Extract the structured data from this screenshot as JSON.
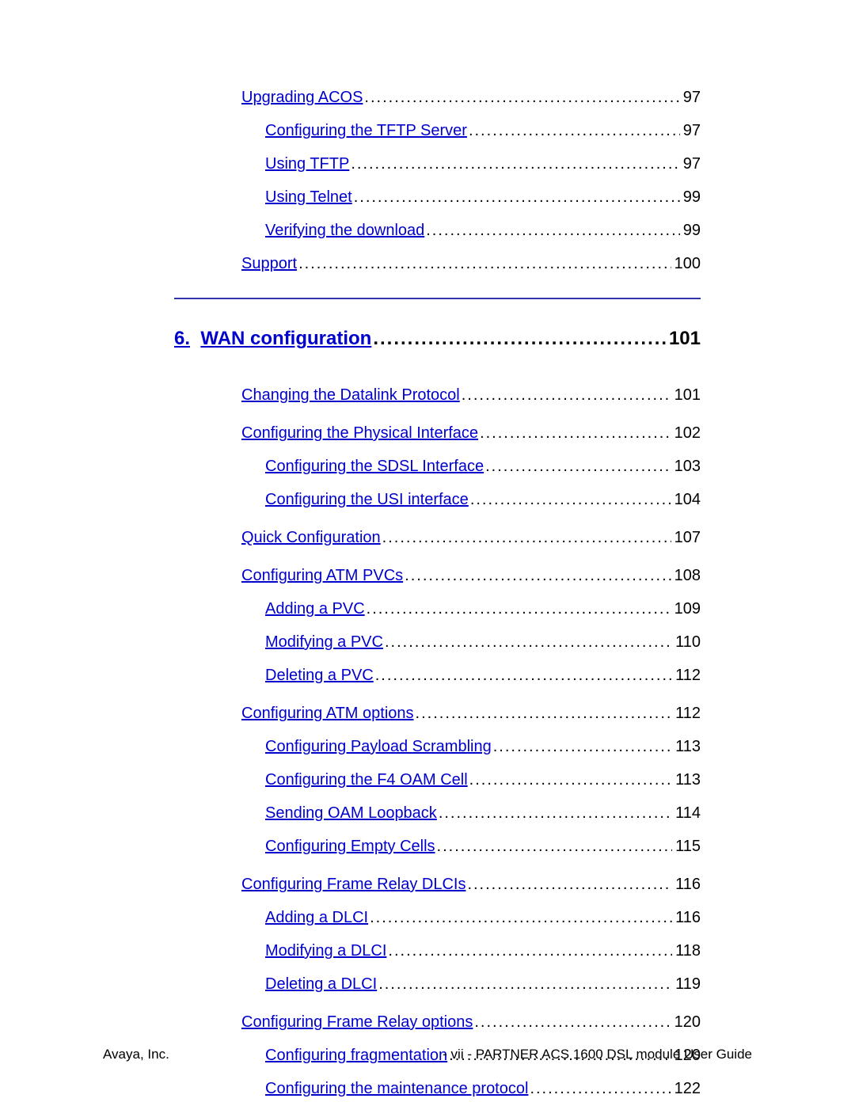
{
  "toc_top": [
    {
      "label": "Upgrading ACOS",
      "page": "97",
      "indent": 1
    },
    {
      "label": "Configuring the TFTP Server",
      "page": "97",
      "indent": 2
    },
    {
      "label": "Using TFTP",
      "page": "97",
      "indent": 2
    },
    {
      "label": "Using Telnet",
      "page": "99",
      "indent": 2
    },
    {
      "label": "Verifying the download",
      "page": "99",
      "indent": 2
    },
    {
      "label": "Support",
      "page": "100",
      "indent": 1
    }
  ],
  "chapter": {
    "number": "6.",
    "title": "WAN configuration",
    "page": "101"
  },
  "toc_chapter": [
    [
      {
        "label": "Changing the Datalink Protocol",
        "page": "101",
        "indent": 1
      }
    ],
    [
      {
        "label": "Configuring the Physical Interface",
        "page": "102",
        "indent": 1
      },
      {
        "label": "Configuring the SDSL Interface",
        "page": "103",
        "indent": 2
      },
      {
        "label": "Configuring the USI interface",
        "page": "104",
        "indent": 2
      }
    ],
    [
      {
        "label": "Quick Configuration",
        "page": "107",
        "indent": 1
      }
    ],
    [
      {
        "label": "Configuring ATM PVCs",
        "page": "108",
        "indent": 1
      },
      {
        "label": "Adding a PVC",
        "page": "109",
        "indent": 2
      },
      {
        "label": "Modifying a PVC",
        "page": "110",
        "indent": 2
      },
      {
        "label": "Deleting a PVC",
        "page": "112",
        "indent": 2
      }
    ],
    [
      {
        "label": "Configuring ATM options",
        "page": "112",
        "indent": 1
      },
      {
        "label": "Configuring Payload Scrambling",
        "page": "113",
        "indent": 2
      },
      {
        "label": "Configuring the F4 OAM Cell",
        "page": "113",
        "indent": 2
      },
      {
        "label": "Sending OAM Loopback",
        "page": "114",
        "indent": 2
      },
      {
        "label": "Configuring Empty Cells",
        "page": "115",
        "indent": 2
      }
    ],
    [
      {
        "label": "Configuring Frame Relay DLCIs",
        "page": "116",
        "indent": 1
      },
      {
        "label": "Adding a DLCI",
        "page": "116",
        "indent": 2
      },
      {
        "label": "Modifying a DLCI",
        "page": "118",
        "indent": 2
      },
      {
        "label": "Deleting a DLCI",
        "page": "119",
        "indent": 2
      }
    ],
    [
      {
        "label": "Configuring Frame Relay options",
        "page": "120",
        "indent": 1
      },
      {
        "label": "Configuring fragmentation",
        "page": "120",
        "indent": 2
      },
      {
        "label": "Configuring the maintenance protocol",
        "page": "122",
        "indent": 2
      }
    ]
  ],
  "footer": {
    "left": "Avaya, Inc.",
    "right": "- vii -   PARTNER ACS 1600 DSL module User Guide"
  }
}
